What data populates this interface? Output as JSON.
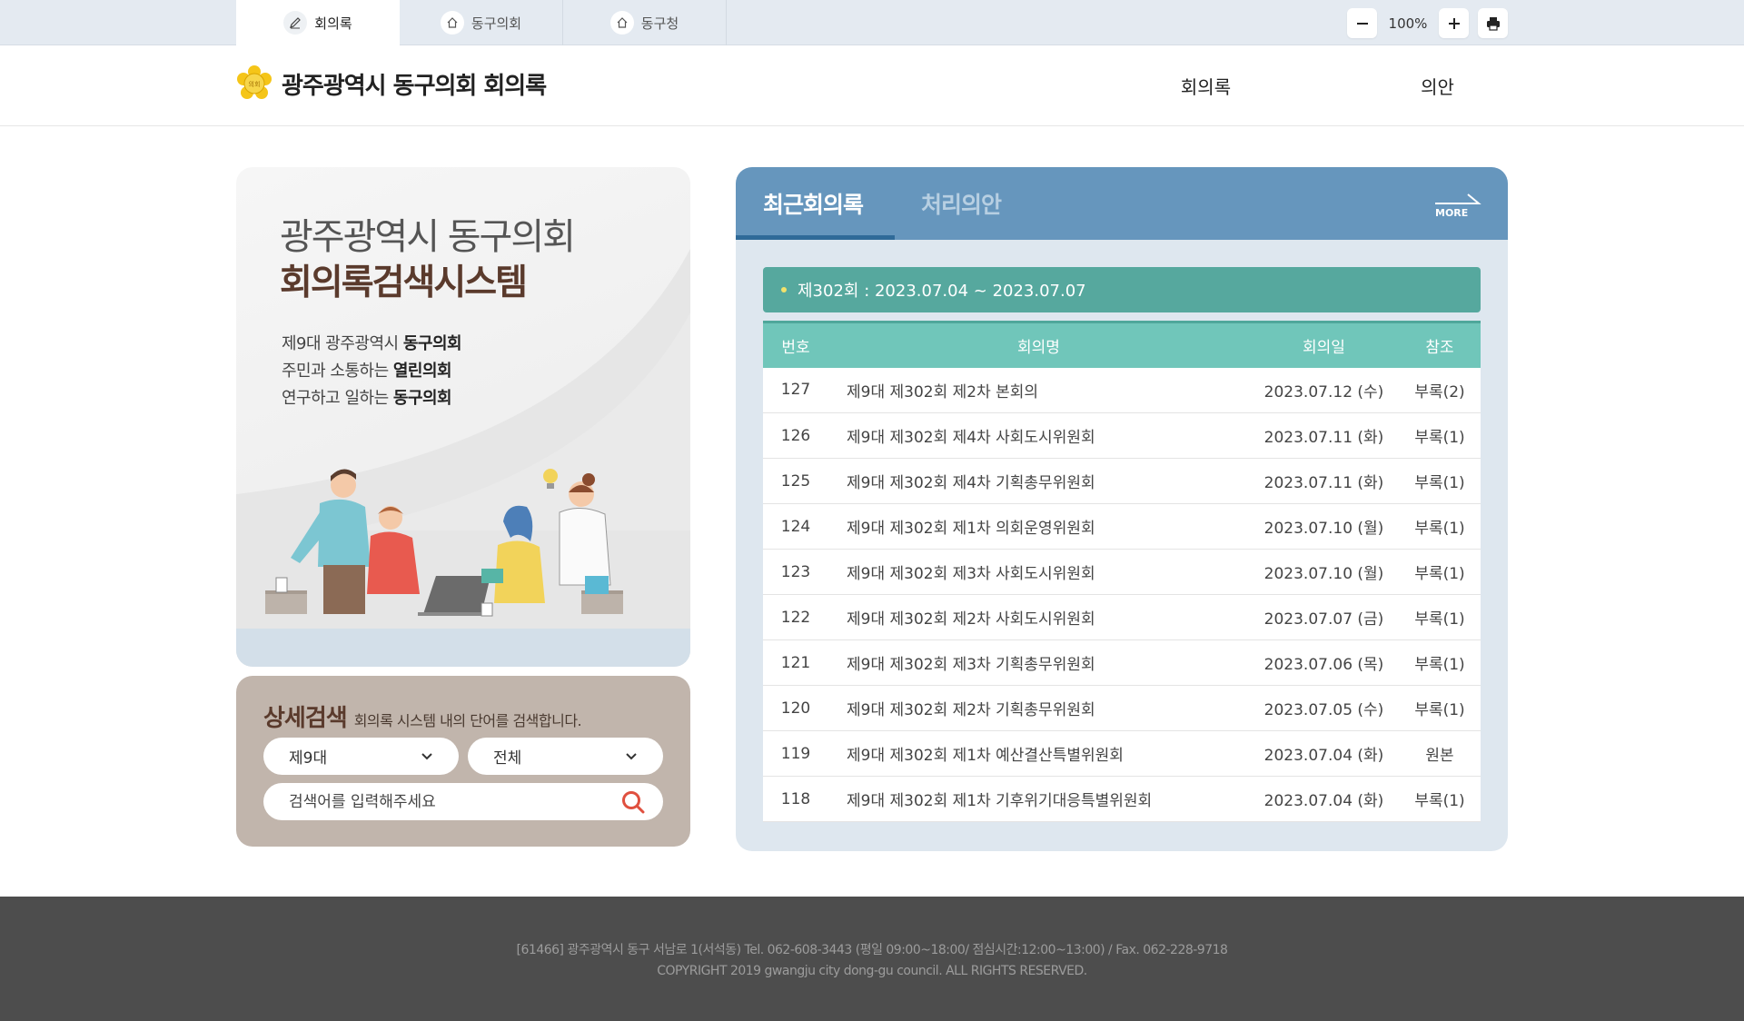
{
  "topbar": {
    "tabs": [
      {
        "label": "회의록",
        "icon": "pencil-icon",
        "active": true
      },
      {
        "label": "동구의회",
        "icon": "home-icon",
        "active": false
      },
      {
        "label": "동구청",
        "icon": "home-icon",
        "active": false
      }
    ],
    "zoom": {
      "value": "100%",
      "minus_icon": "minus-icon",
      "plus_icon": "plus-icon",
      "print_icon": "print-icon"
    }
  },
  "header": {
    "logo_emblem": "의회",
    "title": "광주광역시 동구의회 회의록",
    "nav": [
      "회의록",
      "의안"
    ]
  },
  "hero": {
    "line1": "광주광역시 동구의회",
    "line2": "회의록검색시스템",
    "slogans": [
      {
        "prefix": "제9대 광주광역시 ",
        "bold": "동구의회"
      },
      {
        "prefix": "주민과 소통하는 ",
        "bold": "열린의회"
      },
      {
        "prefix": "연구하고 일하는 ",
        "bold": "동구의회"
      }
    ]
  },
  "search": {
    "title": "상세검색",
    "description": "회의록 시스템 내의 단어를 검색합니다.",
    "select_term": "제9대",
    "select_type": "전체",
    "placeholder": "검색어를 입력해주세요"
  },
  "panel": {
    "tabs": [
      "최근회의록",
      "처리의안"
    ],
    "more_label": "MORE",
    "session": "제302회 : 2023.07.04 ~ 2023.07.07",
    "columns": [
      "번호",
      "회의명",
      "회의일",
      "참조"
    ],
    "rows": [
      {
        "no": "127",
        "name": "제9대 제302회 제2차 본회의",
        "date": "2023.07.12 (수)",
        "ref": "부록(2)"
      },
      {
        "no": "126",
        "name": "제9대 제302회 제4차 사회도시위원회",
        "date": "2023.07.11 (화)",
        "ref": "부록(1)"
      },
      {
        "no": "125",
        "name": "제9대 제302회 제4차 기획총무위원회",
        "date": "2023.07.11 (화)",
        "ref": "부록(1)"
      },
      {
        "no": "124",
        "name": "제9대 제302회 제1차 의회운영위원회",
        "date": "2023.07.10 (월)",
        "ref": "부록(1)"
      },
      {
        "no": "123",
        "name": "제9대 제302회 제3차 사회도시위원회",
        "date": "2023.07.10 (월)",
        "ref": "부록(1)"
      },
      {
        "no": "122",
        "name": "제9대 제302회 제2차 사회도시위원회",
        "date": "2023.07.07 (금)",
        "ref": "부록(1)"
      },
      {
        "no": "121",
        "name": "제9대 제302회 제3차 기획총무위원회",
        "date": "2023.07.06 (목)",
        "ref": "부록(1)"
      },
      {
        "no": "120",
        "name": "제9대 제302회 제2차 기획총무위원회",
        "date": "2023.07.05 (수)",
        "ref": "부록(1)"
      },
      {
        "no": "119",
        "name": "제9대 제302회 제1차 예산결산특별위원회",
        "date": "2023.07.04 (화)",
        "ref": "원본"
      },
      {
        "no": "118",
        "name": "제9대 제302회 제1차 기후위기대응특별위원회",
        "date": "2023.07.04 (화)",
        "ref": "부록(1)"
      }
    ]
  },
  "footer": {
    "address": "[61466] 광주광역시 동구 서남로 1(서석동) Tel. 062-608-3443 (평일 09:00~18:00/ 점심시간:12:00~13:00) / Fax. 062-228-9718",
    "copyright": "COPYRIGHT 2019 gwangju city dong-gu council. ALL RIGHTS RESERVED."
  },
  "colors": {
    "panel_header": "#6696bd",
    "session_bar": "#56a89e",
    "table_header": "#70c6ba",
    "search_card": "#c1b5ac",
    "footer": "#4d4d4d"
  }
}
